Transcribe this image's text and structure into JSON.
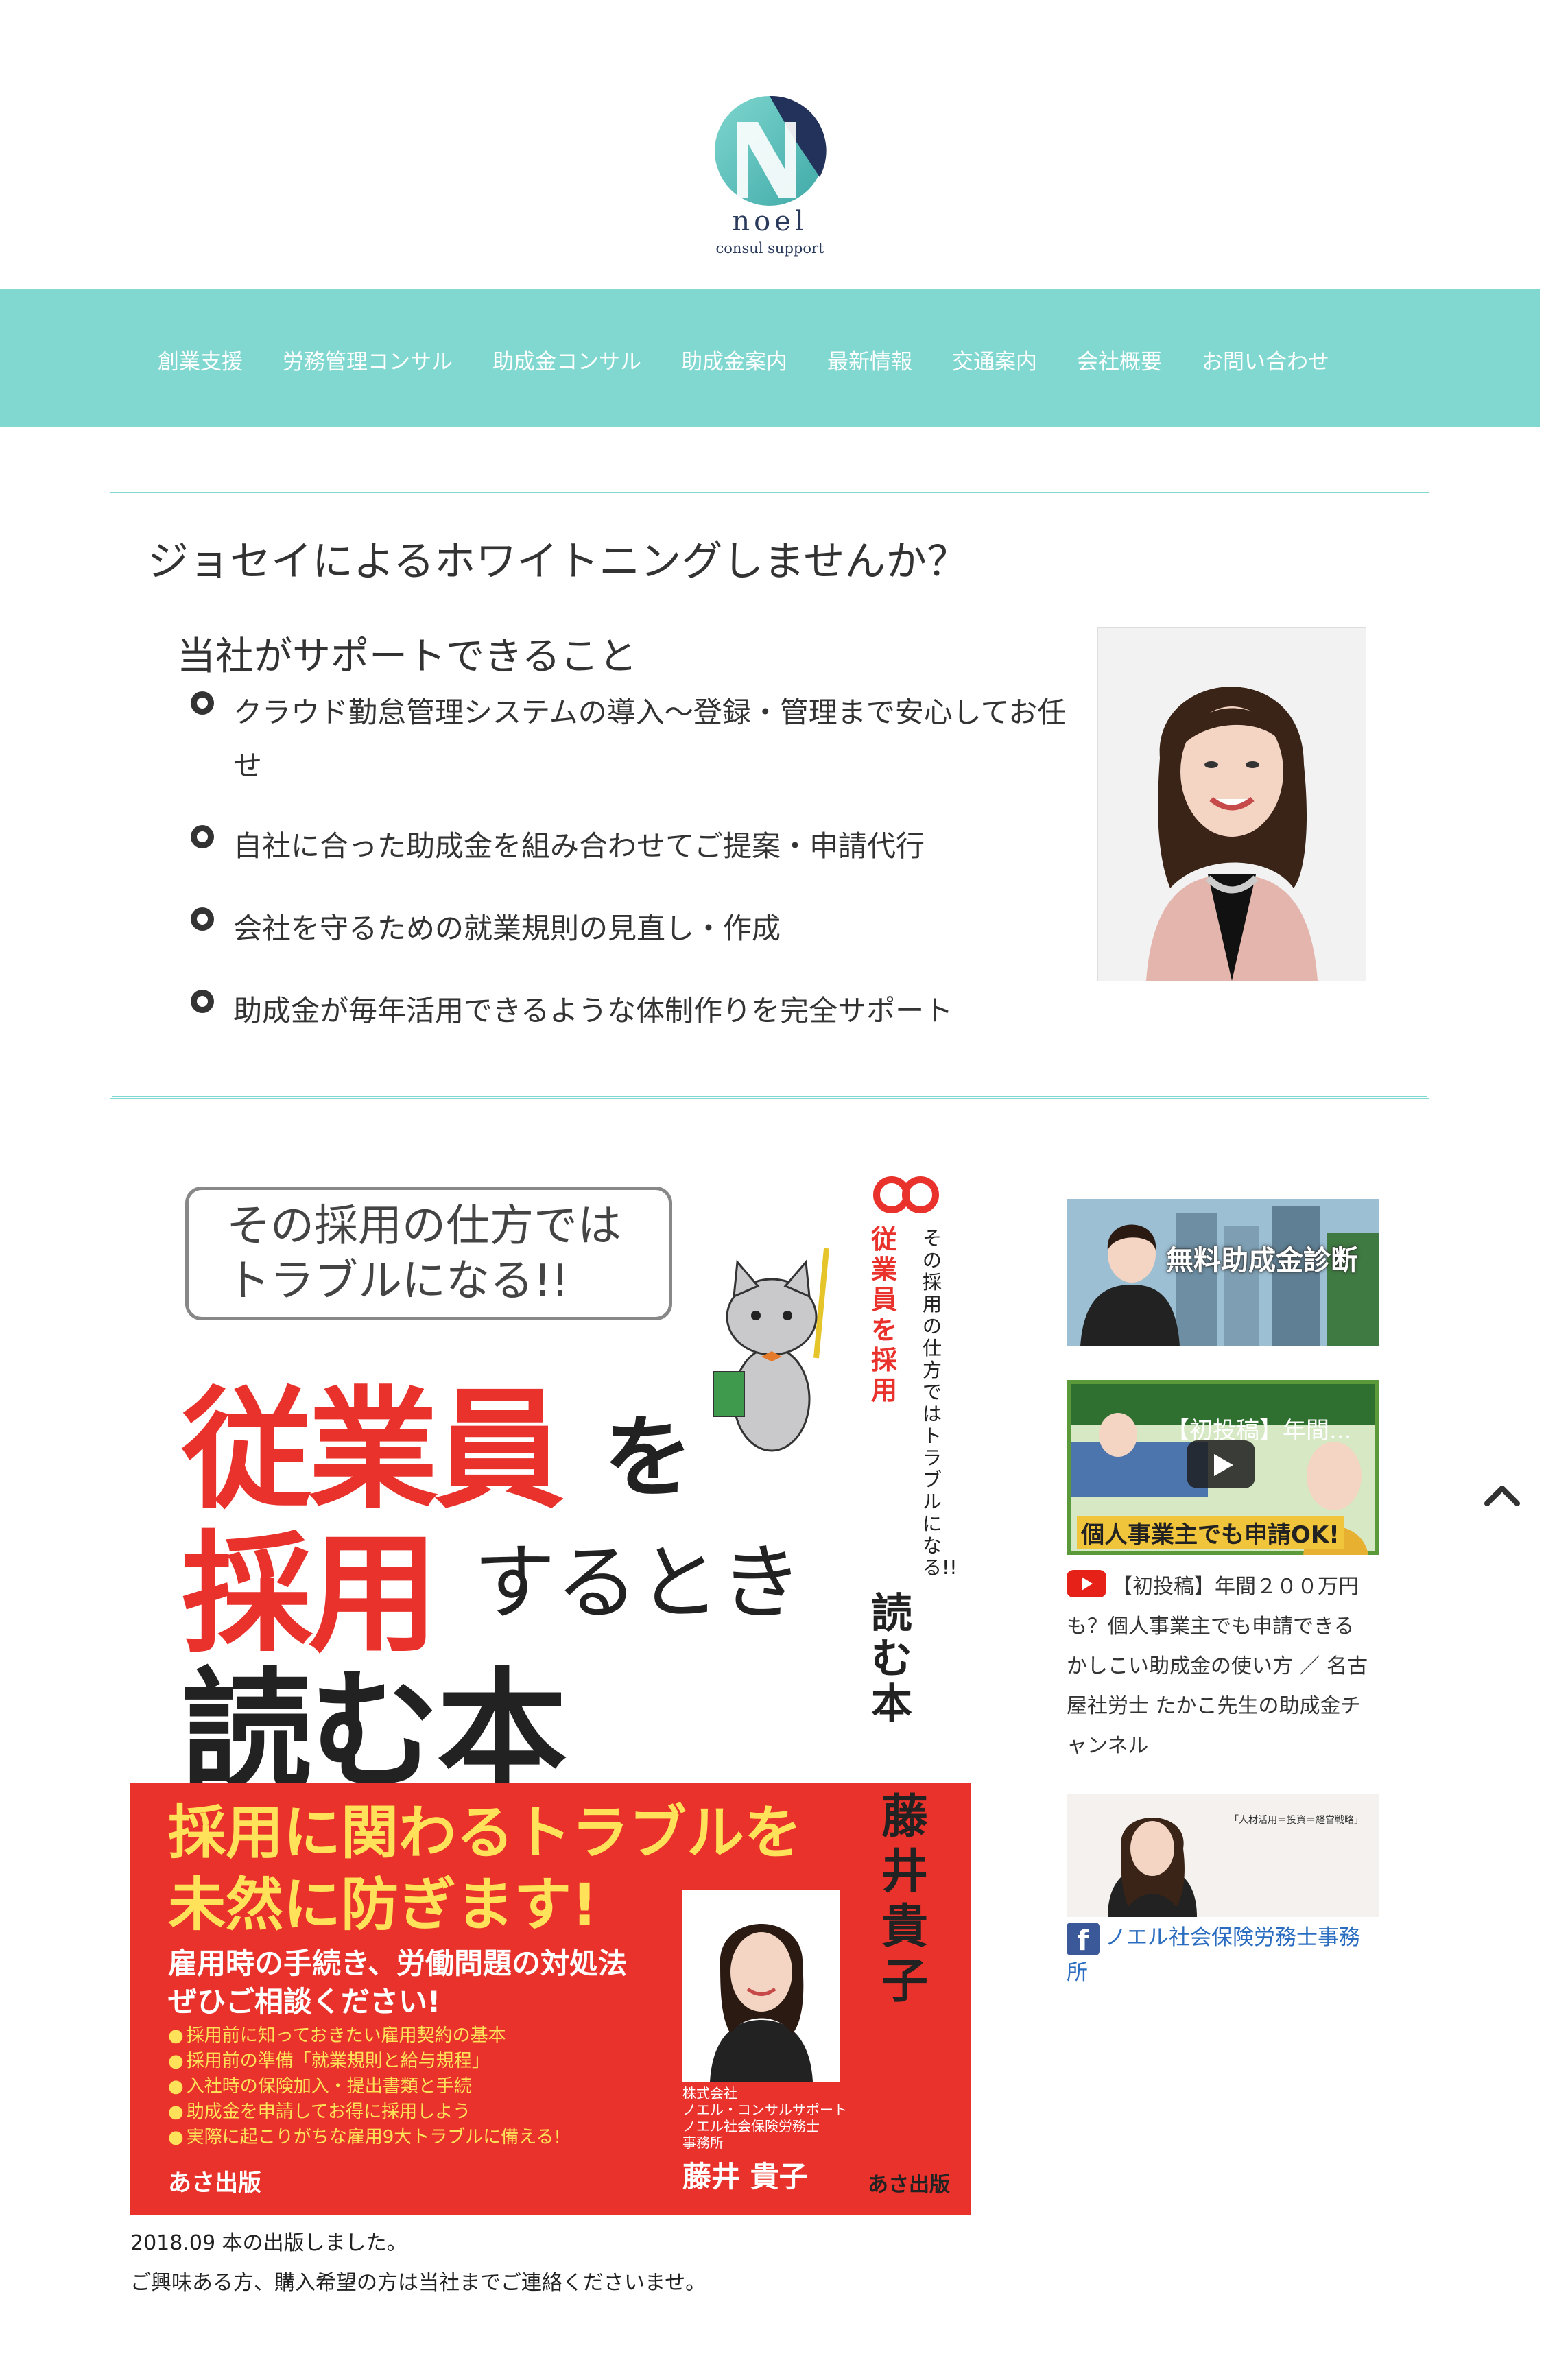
{
  "header": {
    "logo_name": "noel",
    "logo_sub": "consul support"
  },
  "nav": {
    "items": [
      "創業支援",
      "労務管理コンサル",
      "助成金コンサル",
      "助成金案内",
      "最新情報",
      "交通案内",
      "会社概要",
      "お問い合わせ"
    ]
  },
  "promo": {
    "title": "ジョセイによるホワイトニングしませんか？",
    "subtitle": "当社がサポートできること",
    "bullets": [
      "クラウド勤怠管理システムの導入～登録・管理まで安心してお任せ",
      "自社に合った助成金を組み合わせてご提案・申請代行",
      "会社を守るための就業規則の見直し・作成",
      "助成金が毎年活用できるような体制作りを完全サポート"
    ]
  },
  "book": {
    "bubble": "その採用の仕方では\nトラブルになる!!",
    "title_red1": "従業員",
    "title_black1": "を",
    "title_red2": "採用",
    "title_black2": "するとき",
    "title_line3": "読む本",
    "spine_sub": "その採用の仕方ではトラブルになる!!",
    "spine_title": "従業員を採用",
    "spine_tail": "読む本",
    "author_vertical": "藤井貴子",
    "red_heading": "採用に関わるトラブルを\n未然に防ぎます!",
    "red_subheading": "雇用時の手続き、労働問題の対処法\nぜひご相談ください!",
    "list": [
      "採用前に知っておきたい雇用契約の基本",
      "採用前の準備「就業規則と給与規程」",
      "入社時の保険加入・提出書類と手続",
      "助成金を申請してお得に採用しよう",
      "実際に起こりがちな雇用9大トラブルに備える!"
    ],
    "company": "株式会社\nノエル・コンサルサポート\nノエル社会保険労務士\n事務所",
    "author": "藤井 貴子",
    "publisher": "あさ出版",
    "caption1": "2018.09 本の出版しました。",
    "caption2": "ご興味ある方、購入希望の方は当社までご連絡くださいませ。"
  },
  "sidebar": {
    "banner1_text": "無料助成金診断",
    "video_title": "【初投稿】年間...",
    "video_bottom": "個人事業主でも申請OK!",
    "yt_description": "【初投稿】年間２００万円も？個人事業主でも申請できる かしこい助成金の使い方 ／ 名古屋社労士 たかこ先生の助成金チャンネル",
    "fb_quote": "「人材活用＝投資＝経営戦略」",
    "fb_link": "ノエル社会保険労務士事務所"
  },
  "colors": {
    "nav_bg": "#80d8d0",
    "accent_red": "#e8322b",
    "link_blue": "#2a6cc0"
  }
}
